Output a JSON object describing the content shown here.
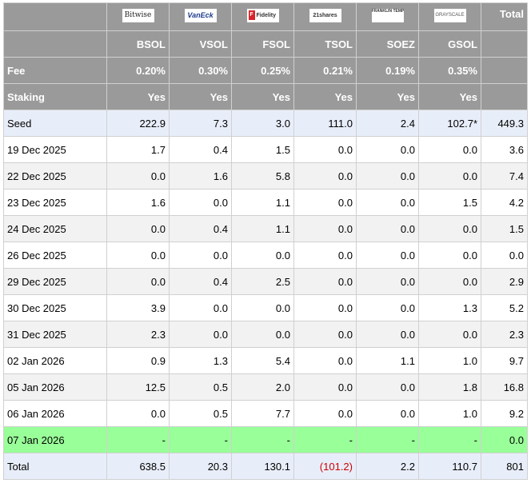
{
  "logos": [
    {
      "label": "Bitwise",
      "style": "bitwise"
    },
    {
      "label": "VanEck",
      "style": "vaneck"
    },
    {
      "label": "Fidelity",
      "style": "fidelity"
    },
    {
      "label": "21shares",
      "style": "plain"
    },
    {
      "label": "FRANKLIN TEMPLETON",
      "style": "franklin"
    },
    {
      "label": "GRAYSCALE",
      "style": "gray"
    }
  ],
  "header": {
    "total_label": "Total",
    "tickers": [
      "BSOL",
      "VSOL",
      "FSOL",
      "TSOL",
      "SOEZ",
      "GSOL"
    ],
    "fee_label": "Fee",
    "fees": [
      "0.20%",
      "0.30%",
      "0.25%",
      "0.21%",
      "0.19%",
      "0.35%"
    ],
    "staking_label": "Staking",
    "staking": [
      "Yes",
      "Yes",
      "Yes",
      "Yes",
      "Yes",
      "Yes"
    ]
  },
  "rows": [
    {
      "label": "Seed",
      "values": [
        "222.9",
        "7.3",
        "3.0",
        "111.0",
        "2.4",
        "102.7*"
      ],
      "total": "449.3",
      "style": "seed"
    },
    {
      "label": "19 Dec 2025",
      "values": [
        "1.7",
        "0.4",
        "1.5",
        "0.0",
        "0.0",
        "0.0"
      ],
      "total": "3.6",
      "style": "white"
    },
    {
      "label": "22 Dec 2025",
      "values": [
        "0.0",
        "1.6",
        "5.8",
        "0.0",
        "0.0",
        "0.0"
      ],
      "total": "7.4",
      "style": "alt"
    },
    {
      "label": "23 Dec 2025",
      "values": [
        "1.6",
        "0.0",
        "1.1",
        "0.0",
        "0.0",
        "1.5"
      ],
      "total": "4.2",
      "style": "white"
    },
    {
      "label": "24 Dec 2025",
      "values": [
        "0.0",
        "0.4",
        "1.1",
        "0.0",
        "0.0",
        "0.0"
      ],
      "total": "1.5",
      "style": "alt"
    },
    {
      "label": "26 Dec 2025",
      "values": [
        "0.0",
        "0.0",
        "0.0",
        "0.0",
        "0.0",
        "0.0"
      ],
      "total": "0.0",
      "style": "white"
    },
    {
      "label": "29 Dec 2025",
      "values": [
        "0.0",
        "0.4",
        "2.5",
        "0.0",
        "0.0",
        "0.0"
      ],
      "total": "2.9",
      "style": "alt"
    },
    {
      "label": "30 Dec 2025",
      "values": [
        "3.9",
        "0.0",
        "0.0",
        "0.0",
        "0.0",
        "1.3"
      ],
      "total": "5.2",
      "style": "white"
    },
    {
      "label": "31 Dec 2025",
      "values": [
        "2.3",
        "0.0",
        "0.0",
        "0.0",
        "0.0",
        "0.0"
      ],
      "total": "2.3",
      "style": "alt"
    },
    {
      "label": "02 Jan 2026",
      "values": [
        "0.9",
        "1.3",
        "5.4",
        "0.0",
        "1.1",
        "1.0"
      ],
      "total": "9.7",
      "style": "white"
    },
    {
      "label": "05 Jan 2026",
      "values": [
        "12.5",
        "0.5",
        "2.0",
        "0.0",
        "0.0",
        "1.8"
      ],
      "total": "16.8",
      "style": "alt"
    },
    {
      "label": "06 Jan 2026",
      "values": [
        "0.0",
        "0.5",
        "7.7",
        "0.0",
        "0.0",
        "1.0"
      ],
      "total": "9.2",
      "style": "white"
    },
    {
      "label": "07 Jan 2026",
      "values": [
        "-",
        "-",
        "-",
        "-",
        "-",
        "-"
      ],
      "total": "0.0",
      "style": "green"
    },
    {
      "label": "Total",
      "values": [
        "638.5",
        "20.3",
        "130.1",
        "(101.2)",
        "2.2",
        "110.7"
      ],
      "total": "801",
      "style": "total",
      "negative_index": 3
    }
  ],
  "colors": {
    "header_bg": "#9a9a9a",
    "seed_bg": "#e8eef9",
    "alt_bg": "#f2f2f2",
    "highlight_bg": "#99ff99",
    "negative_text": "#cc0000"
  }
}
